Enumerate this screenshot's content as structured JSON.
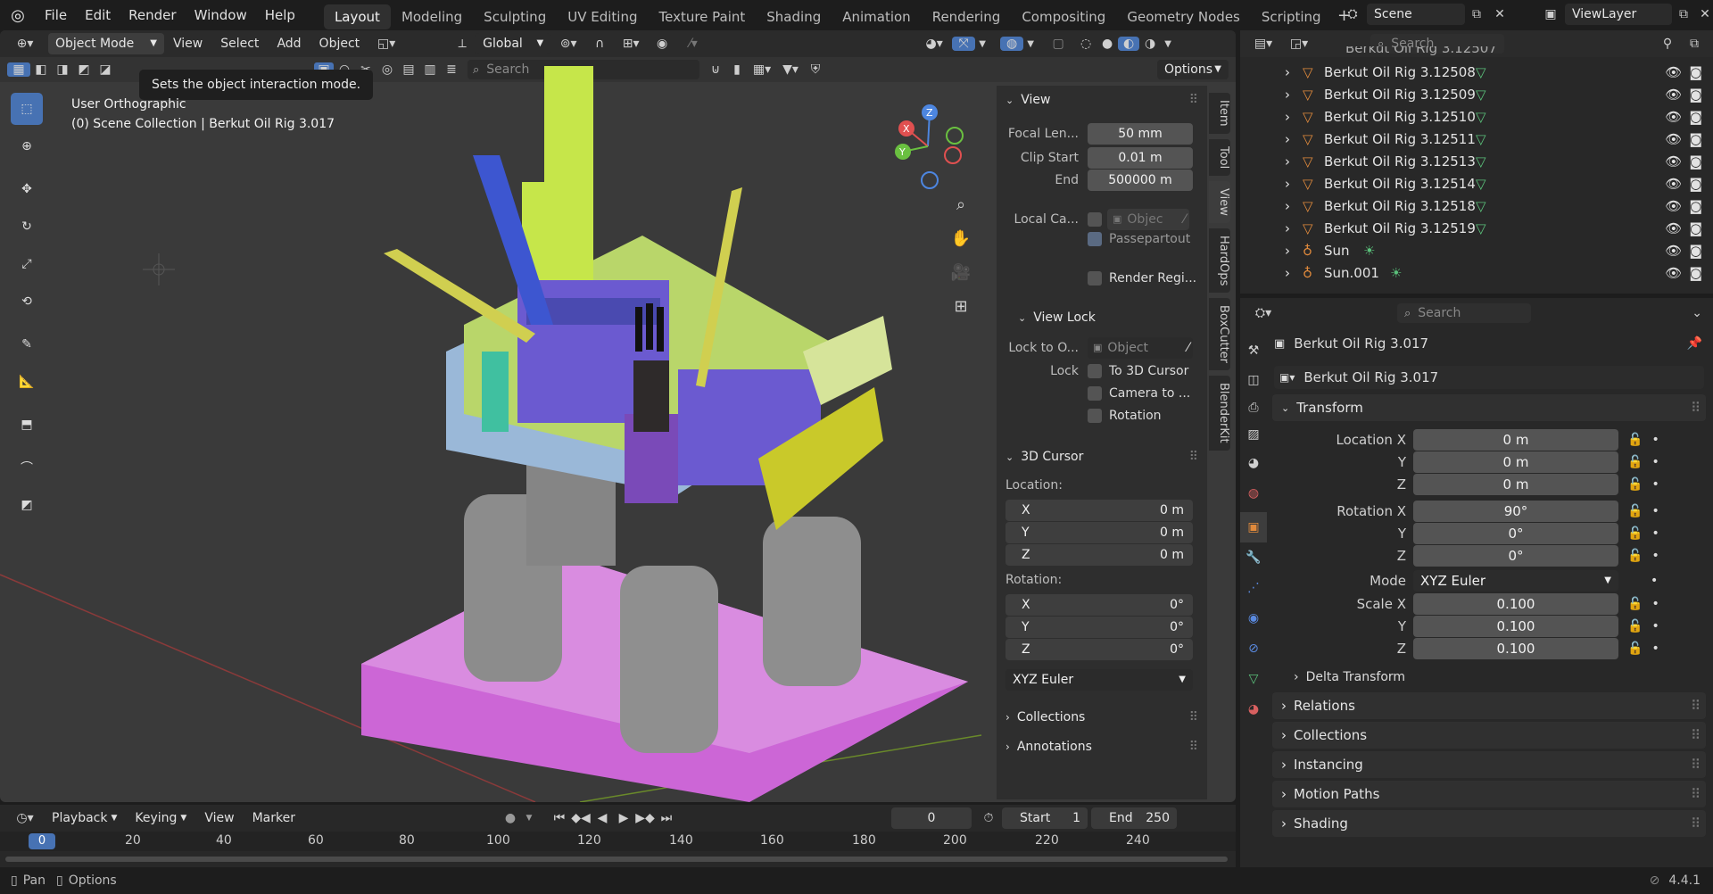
{
  "menu": {
    "file": "File",
    "edit": "Edit",
    "render": "Render",
    "window": "Window",
    "help": "Help"
  },
  "workspaces": [
    "Layout",
    "Modeling",
    "Sculpting",
    "UV Editing",
    "Texture Paint",
    "Shading",
    "Animation",
    "Rendering",
    "Compositing",
    "Geometry Nodes",
    "Scripting"
  ],
  "scene": {
    "name": "Scene",
    "view_layer": "ViewLayer"
  },
  "viewport_header": {
    "mode": "Object Mode",
    "view": "View",
    "select": "Select",
    "add": "Add",
    "object": "Object",
    "orientation": "Global",
    "options": "Options",
    "search_placeholder": "Search"
  },
  "tooltip": "Sets the object interaction mode.",
  "viewport_info": {
    "view_name": "User Orthographic",
    "collection": "(0) Scene Collection | Berkut Oil Rig 3.017"
  },
  "npanel": {
    "tabs": [
      "Item",
      "Tool",
      "View",
      "HardOps",
      "BoxCutter",
      "BlenderKit"
    ],
    "view_title": "View",
    "focal_label": "Focal Len...",
    "focal_value": "50 mm",
    "clip_start_label": "Clip Start",
    "clip_start_value": "0.01 m",
    "clip_end_label": "End",
    "clip_end_value": "500000 m",
    "local_cam_label": "Local Ca...",
    "local_cam_value": "Objec",
    "passepartout": "Passepartout",
    "render_region": "Render Regi...",
    "view_lock_title": "View Lock",
    "lock_to_label": "Lock to O...",
    "lock_to_value": "Object",
    "lock_label": "Lock",
    "lock_cursor": "To 3D Cursor",
    "lock_camera": "Camera to ...",
    "lock_rotation": "Rotation",
    "cursor_title": "3D Cursor",
    "location_label": "Location:",
    "loc_x": "0 m",
    "loc_y": "0 m",
    "loc_z": "0 m",
    "rotation_label": "Rotation:",
    "rot_x": "0°",
    "rot_y": "0°",
    "rot_z": "0°",
    "axis_x": "X",
    "axis_y": "Y",
    "axis_z": "Z",
    "rotation_mode": "XYZ Euler",
    "collections": "Collections",
    "annotations": "Annotations"
  },
  "outliner": {
    "search_placeholder": "Search",
    "top_partial": "Berkut Oil Rig 3.12507",
    "items": [
      "Berkut Oil Rig 3.12508",
      "Berkut Oil Rig 3.12509",
      "Berkut Oil Rig 3.12510",
      "Berkut Oil Rig 3.12511",
      "Berkut Oil Rig 3.12513",
      "Berkut Oil Rig 3.12514",
      "Berkut Oil Rig 3.12518",
      "Berkut Oil Rig 3.12519",
      "Sun",
      "Sun.001"
    ]
  },
  "properties": {
    "search_placeholder": "Search",
    "object_name": "Berkut Oil Rig 3.017",
    "data_name": "Berkut Oil Rig 3.017",
    "transform": "Transform",
    "location_x_label": "Location X",
    "y_label": "Y",
    "z_label": "Z",
    "loc_x": "0 m",
    "loc_y": "0 m",
    "loc_z": "0 m",
    "rotation_x_label": "Rotation X",
    "rot_x": "90°",
    "rot_y": "0°",
    "rot_z": "0°",
    "mode_label": "Mode",
    "mode_value": "XYZ Euler",
    "scale_x_label": "Scale X",
    "scale_x": "0.100",
    "scale_y": "0.100",
    "scale_z": "0.100",
    "delta": "Delta Transform",
    "relations": "Relations",
    "collections": "Collections",
    "instancing": "Instancing",
    "motion_paths": "Motion Paths",
    "shading": "Shading"
  },
  "timeline": {
    "playback": "Playback",
    "keying": "Keying",
    "view": "View",
    "marker": "Marker",
    "current_frame": "0",
    "start_label": "Start",
    "start": "1",
    "end_label": "End",
    "end": "250",
    "ruler": [
      "0",
      "20",
      "40",
      "60",
      "80",
      "100",
      "120",
      "140",
      "160",
      "180",
      "200",
      "220",
      "240"
    ]
  },
  "status": {
    "pan": "Pan",
    "options": "Options",
    "version": "4.4.1"
  }
}
